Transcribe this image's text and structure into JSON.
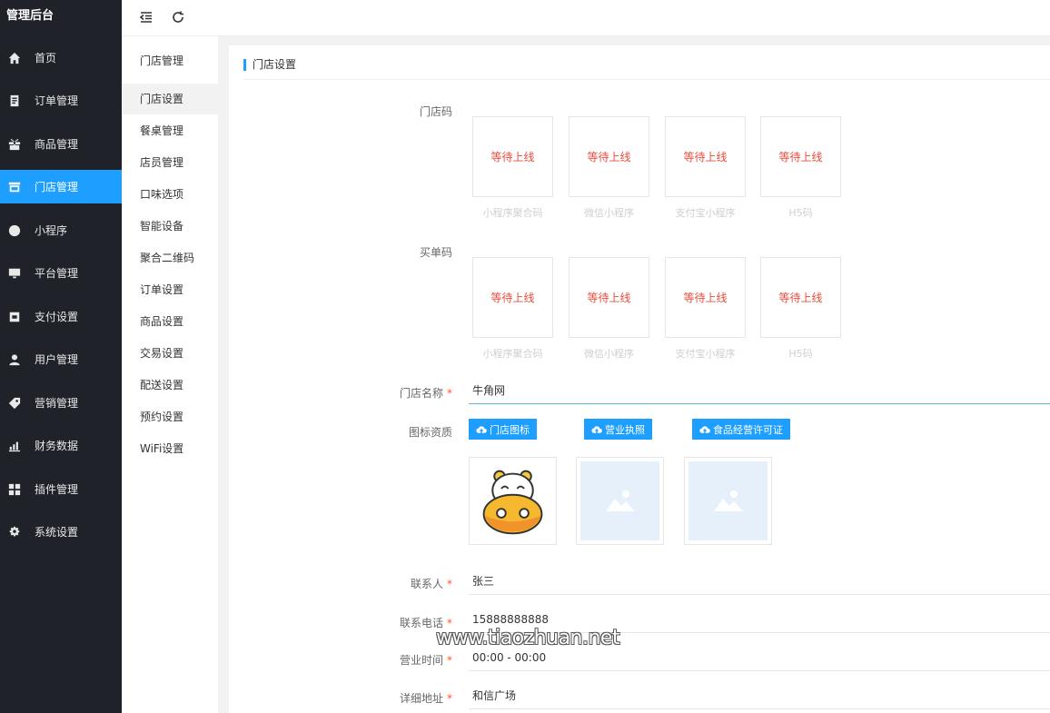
{
  "brand": "管理后台",
  "nav": [
    {
      "label": "首页",
      "icon": "home-icon"
    },
    {
      "label": "订单管理",
      "icon": "order-icon"
    },
    {
      "label": "商品管理",
      "icon": "gift-icon"
    },
    {
      "label": "门店管理",
      "icon": "store-icon"
    },
    {
      "label": "小程序",
      "icon": "miniprogram-icon"
    },
    {
      "label": "平台管理",
      "icon": "monitor-icon"
    },
    {
      "label": "支付设置",
      "icon": "wallet-icon"
    },
    {
      "label": "用户管理",
      "icon": "user-icon"
    },
    {
      "label": "营销管理",
      "icon": "tag-icon"
    },
    {
      "label": "财务数据",
      "icon": "chart-icon"
    },
    {
      "label": "插件管理",
      "icon": "grid-icon"
    },
    {
      "label": "系统设置",
      "icon": "gear-icon"
    }
  ],
  "submenu": {
    "title": "门店管理",
    "items": [
      "门店设置",
      "餐桌管理",
      "店员管理",
      "口味选项",
      "智能设备",
      "聚合二维码",
      "订单设置",
      "商品设置",
      "交易设置",
      "配送设置",
      "预约设置",
      "WiFi设置"
    ]
  },
  "page_title": "门店设置",
  "form": {
    "store_code_label": "门店码",
    "pay_code_label": "买单码",
    "qr_status": "等待上线",
    "qr_captions": [
      "小程序聚合码",
      "微信小程序",
      "支付宝小程序",
      "H5码"
    ],
    "store_name_label": "门店名称",
    "store_name_value": "牛角网",
    "cert_label": "图标资质",
    "upload_buttons": [
      "门店图标",
      "营业执照",
      "食品经营许可证"
    ],
    "contact_label": "联系人",
    "contact_value": "张三",
    "phone_label": "联系电话",
    "phone_value": "15888888888",
    "hours_label": "营业时间",
    "hours_value": "00:00 - 00:00",
    "address_label": "详细地址",
    "address_value": "和信广场"
  },
  "watermark": "www.tiaozhuan.net"
}
